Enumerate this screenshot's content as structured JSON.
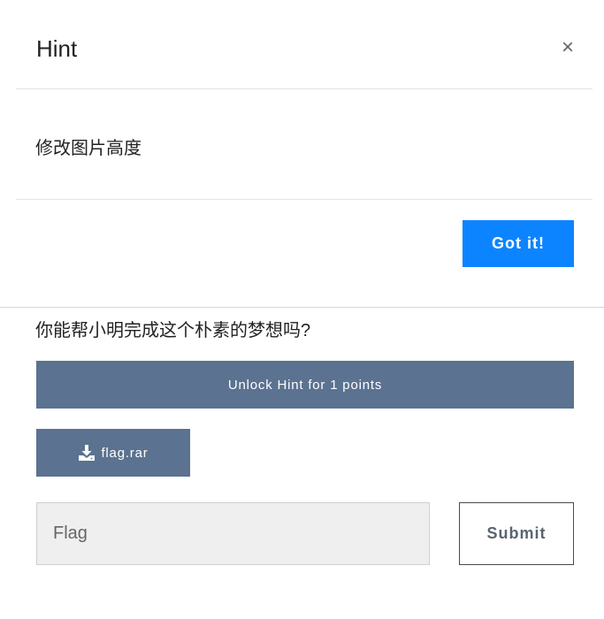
{
  "modal": {
    "title": "Hint",
    "close_glyph": "×",
    "body_text": "修改图片高度",
    "confirm_label": "Got it!"
  },
  "challenge": {
    "description": "你能帮小明完成这个朴素的梦想吗?",
    "unlock_label": "Unlock Hint for 1 points",
    "file_label": "flag.rar",
    "file_icon": "download-icon",
    "flag_placeholder": "Flag",
    "flag_value": "",
    "submit_label": "Submit"
  },
  "colors": {
    "primary": "#0d84ff",
    "secondary": "#5b7290",
    "input_bg": "#efefef"
  }
}
